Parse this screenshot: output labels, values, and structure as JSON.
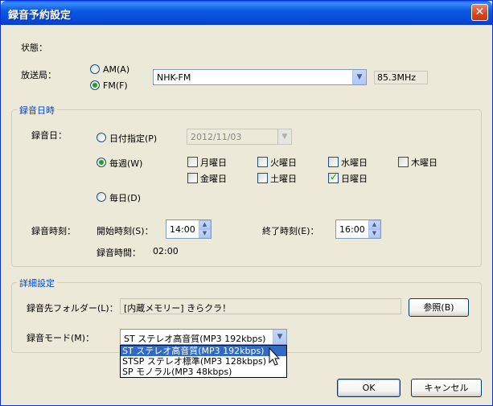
{
  "window": {
    "title": "録音予約設定",
    "close_glyph": "✕"
  },
  "status": {
    "label": "状態："
  },
  "station": {
    "label": "放送局：",
    "am_label": "AM(A)",
    "fm_label": "FM(F)",
    "selected_band": "FM",
    "station_value": "NHK-FM",
    "frequency": "85.3MHz"
  },
  "datetime_group": {
    "label": "録音日時",
    "date_label": "録音日：",
    "date_specified_label": "日付指定(P)",
    "date_value": "2012/11/03",
    "weekly_label": "毎週(W)",
    "daily_label": "毎日(D)",
    "selected_mode": "weekly",
    "weekdays": [
      {
        "label": "月曜日",
        "checked": false
      },
      {
        "label": "火曜日",
        "checked": false
      },
      {
        "label": "水曜日",
        "checked": false
      },
      {
        "label": "木曜日",
        "checked": false
      },
      {
        "label": "金曜日",
        "checked": false
      },
      {
        "label": "土曜日",
        "checked": false
      },
      {
        "label": "日曜日",
        "checked": true
      }
    ],
    "time_label": "録音時刻：",
    "start_label": "開始時刻(S)：",
    "start_value": "14:00",
    "end_label": "終了時刻(E)：",
    "end_value": "16:00",
    "duration_label": "録音時間：",
    "duration_value": "02:00"
  },
  "detail_group": {
    "label": "詳細設定",
    "folder_label": "録音先フォルダー(L)：",
    "folder_value": "[内蔵メモリー] きらクラ！",
    "browse_label": "参照(B)",
    "mode_label": "録音モード(M)：",
    "mode_value": "ST ステレオ高音質(MP3 192kbps)",
    "mode_options": [
      "ST ステレオ高音質(MP3 192kbps)",
      "STSP ステレオ標準(MP3 128kbps)",
      "SP モノラル(MP3 48kbps)"
    ],
    "highlighted_option_index": 0
  },
  "buttons": {
    "ok_label": "OK",
    "cancel_label": "キャンセル"
  },
  "colors": {
    "titlebar": "#0a5fe8",
    "group_label": "#0046d5",
    "selection": "#316ac5",
    "check_mark": "#21a121"
  },
  "icons": {
    "dropdown": "chevron-down-icon",
    "spin_up": "spin-up-icon",
    "spin_down": "spin-down-icon",
    "close": "close-icon",
    "cursor": "mouse-pointer-icon"
  }
}
